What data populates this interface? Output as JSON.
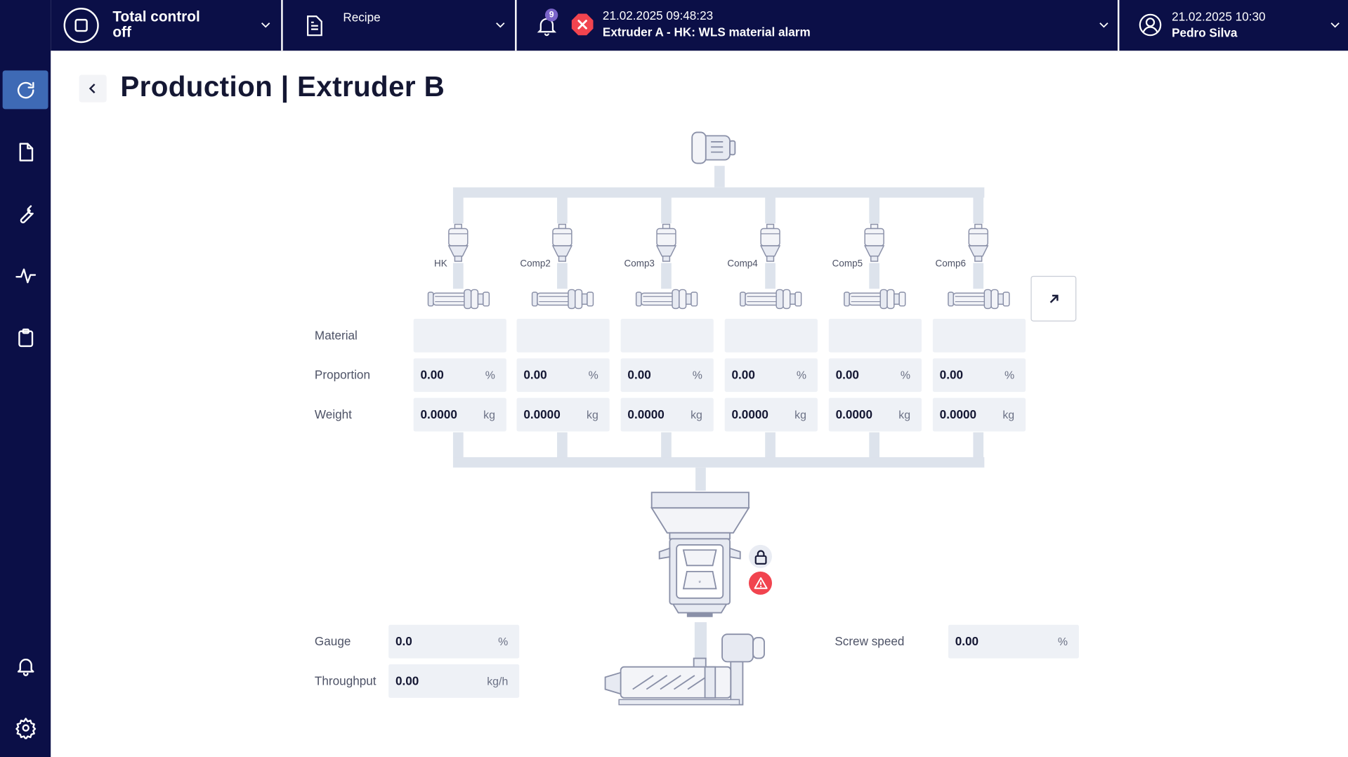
{
  "topbar": {
    "total_control_line1": "Total control",
    "total_control_line2": "off",
    "recipe_label": "Recipe",
    "notification_count": "9",
    "alarm_time": "21.02.2025 09:48:23",
    "alarm_text": "Extruder A - HK: WLS material alarm",
    "user_time": "21.02.2025 10:30",
    "user_name": "Pedro Silva"
  },
  "sidebar": {
    "items": [
      "refresh-icon",
      "document-icon",
      "wrench-icon",
      "activity-icon",
      "clipboard-icon",
      "bell-icon",
      "gear-icon"
    ],
    "active_item": "refresh-icon"
  },
  "page": {
    "title": "Production | Extruder B"
  },
  "components": [
    {
      "name": "HK",
      "material": "",
      "proportion": "0.00",
      "weight": "0.0000"
    },
    {
      "name": "Comp2",
      "material": "",
      "proportion": "0.00",
      "weight": "0.0000"
    },
    {
      "name": "Comp3",
      "material": "",
      "proportion": "0.00",
      "weight": "0.0000"
    },
    {
      "name": "Comp4",
      "material": "",
      "proportion": "0.00",
      "weight": "0.0000"
    },
    {
      "name": "Comp5",
      "material": "",
      "proportion": "0.00",
      "weight": "0.0000"
    },
    {
      "name": "Comp6",
      "material": "",
      "proportion": "0.00",
      "weight": "0.0000"
    }
  ],
  "labels": {
    "material": "Material",
    "proportion": "Proportion",
    "weight": "Weight",
    "percent_unit": "%",
    "kg_unit": "kg"
  },
  "metrics": {
    "gauge_label": "Gauge",
    "gauge_value": "0.0",
    "gauge_unit": "%",
    "throughput_label": "Throughput",
    "throughput_value": "0.00",
    "throughput_unit": "kg/h",
    "screw_speed_label": "Screw speed",
    "screw_speed_value": "0.00",
    "screw_speed_unit": "%"
  },
  "colors": {
    "nav_bg": "#0b0f47",
    "active": "#3e6ab5",
    "alarm": "#f1444f",
    "field_bg": "#eef1f6",
    "pipe": "#dde3ec"
  }
}
